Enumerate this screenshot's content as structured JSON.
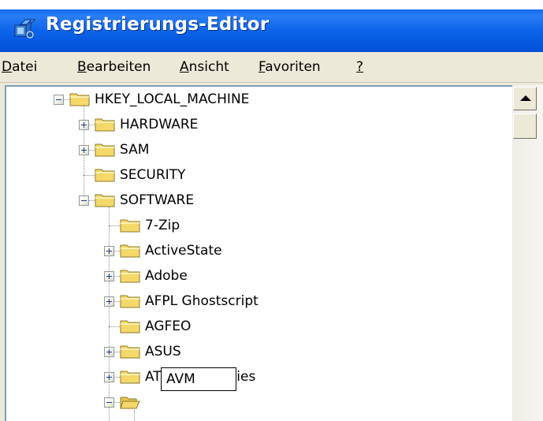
{
  "window": {
    "title": "Registrierungs-Editor",
    "icon": "registry-editor-icon"
  },
  "menu": [
    {
      "prefix": "",
      "accel": "D",
      "rest": "atei"
    },
    {
      "prefix": "",
      "accel": "B",
      "rest": "earbeiten"
    },
    {
      "prefix": "",
      "accel": "A",
      "rest": "nsicht"
    },
    {
      "prefix": "",
      "accel": "F",
      "rest": "avoriten"
    },
    {
      "prefix": "",
      "accel": "?",
      "rest": ""
    }
  ],
  "tree": {
    "root": {
      "label": "HKEY_LOCAL_MACHINE",
      "expanded": true
    },
    "level1": [
      {
        "label": "HARDWARE",
        "expander": "plus"
      },
      {
        "label": "SAM",
        "expander": "plus"
      },
      {
        "label": "SECURITY",
        "expander": "none"
      },
      {
        "label": "SOFTWARE",
        "expander": "minus"
      }
    ],
    "software_children": [
      {
        "label": "7-Zip",
        "expander": "none"
      },
      {
        "label": "ActiveState",
        "expander": "plus"
      },
      {
        "label": "Adobe",
        "expander": "plus"
      },
      {
        "label": "AFPL Ghostscript",
        "expander": "plus"
      },
      {
        "label": "AGFEO",
        "expander": "none"
      },
      {
        "label": "ASUS",
        "expander": "plus"
      },
      {
        "label": "ATI Technologies",
        "expander": "plus"
      }
    ],
    "editing_node": {
      "value": "AVM",
      "expander": "minus"
    }
  },
  "colors": {
    "titlebar": "#0058e6",
    "folder": "#f5d86a",
    "chrome": "#ece9d8"
  }
}
